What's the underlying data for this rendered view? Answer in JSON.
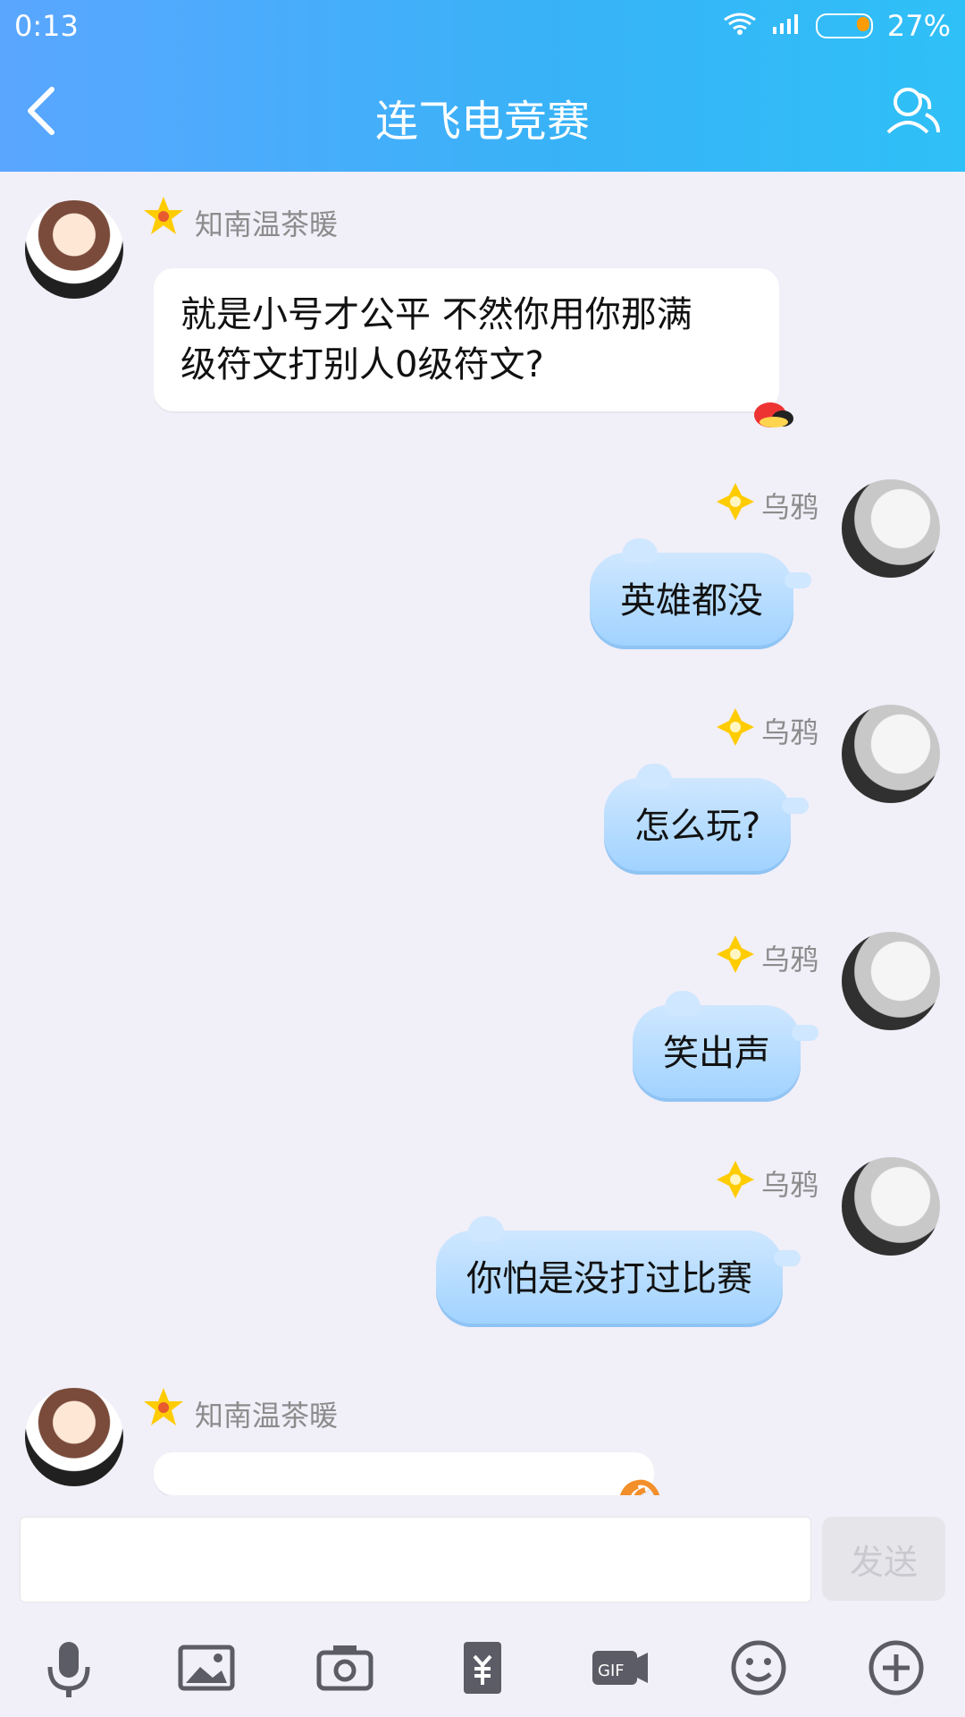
{
  "status": {
    "time": "0:13",
    "battery_percent": "27%"
  },
  "header": {
    "title": "连飞电竞赛"
  },
  "messages": [
    {
      "sender": "知南温茶暖",
      "text_lines": [
        "就是小号才公平 不然你用你那满",
        "级符文打别人0级符文?"
      ]
    },
    {
      "sender": "乌鸦",
      "text": "英雄都没"
    },
    {
      "sender": "乌鸦",
      "text": "怎么玩?"
    },
    {
      "sender": "乌鸦",
      "text": "笑出声"
    },
    {
      "sender": "乌鸦",
      "text": "你怕是没打过比赛"
    },
    {
      "sender": "知南温茶暖"
    }
  ],
  "input": {
    "send_label": "发送"
  },
  "toolbar": {
    "icons": [
      "microphone-icon",
      "image-icon",
      "camera-icon",
      "red-envelope-icon",
      "gif-icon",
      "emoji-icon",
      "plus-icon"
    ]
  },
  "colors": {
    "header_start": "#5aa6ff",
    "header_end": "#2fc0f7",
    "bubble_right": "#9fd2ff",
    "star": "#ffcc00"
  }
}
